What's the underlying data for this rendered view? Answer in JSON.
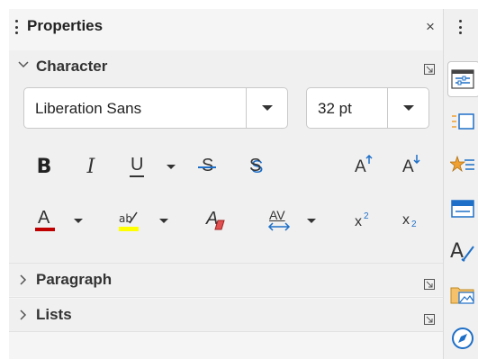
{
  "panel": {
    "title": "Properties",
    "close_label": "×"
  },
  "sections": {
    "character": {
      "label": "Character",
      "expanded": true
    },
    "paragraph": {
      "label": "Paragraph",
      "expanded": false
    },
    "lists": {
      "label": "Lists",
      "expanded": false
    }
  },
  "character": {
    "font_name": "Liberation Sans",
    "font_size": "32 pt",
    "row1": {
      "bold": "B",
      "italic": "I",
      "underline": "U",
      "strike": "S",
      "shadow": "S",
      "grow": "A",
      "shrink": "A"
    },
    "row2": {
      "font_color": "A",
      "clear": "A",
      "spacing": "AV",
      "superscript": "x",
      "superscript_exp": "2",
      "subscript": "x",
      "subscript_exp": "2"
    }
  },
  "colors": {
    "font_color_bar": "#c00000",
    "highlight_bar": "#ffff00",
    "accent_blue": "#1e6fc7",
    "accent_orange": "#f0a030"
  },
  "sidebar_tabs": [
    "properties-icon",
    "styles-icon",
    "gallery-icon",
    "navigator-slide-icon",
    "character-style-icon",
    "image-gallery-icon",
    "navigator-icon"
  ]
}
